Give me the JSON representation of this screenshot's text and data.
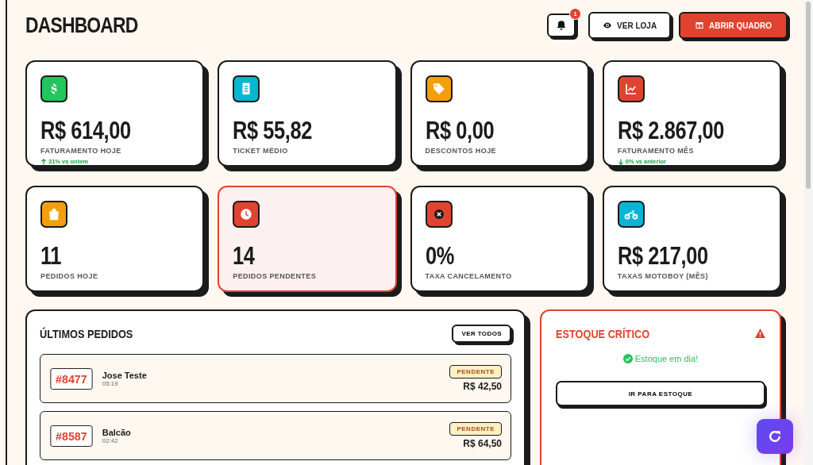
{
  "header": {
    "title": "DASHBOARD",
    "notifications": "1",
    "buttons": [
      {
        "label": "VER LOJA",
        "kind": "outline"
      },
      {
        "label": "ABRIR QUADRO",
        "kind": "primary"
      }
    ]
  },
  "stats": [
    {
      "kind": "dollar",
      "color": "#22c55e",
      "value": "R$ 614,00",
      "label": "FATURAMENTO HOJE",
      "trend": {
        "kind": "up",
        "text": "31% vs ontem"
      },
      "alert": false
    },
    {
      "kind": "receipt",
      "color": "#06b6d4",
      "value": "R$ 55,82",
      "label": "TICKET MÉDIO",
      "alert": false
    },
    {
      "kind": "tag",
      "color": "#f59e0b",
      "value": "R$ 0,00",
      "label": "DESCONTOS HOJE",
      "alert": false
    },
    {
      "kind": "chart",
      "color": "#e0432f",
      "value": "R$ 2.867,00",
      "label": "FATURAMENTO MÊS",
      "trend": {
        "kind": "down",
        "text": "0% vs anterior"
      },
      "alert": false
    },
    {
      "kind": "bag",
      "color": "#f59e0b",
      "value": "11",
      "label": "PEDIDOS HOJE",
      "alert": false
    },
    {
      "kind": "clock",
      "color": "#e0432f",
      "value": "14",
      "label": "PEDIDOS PENDENTES",
      "alert": true
    },
    {
      "kind": "cancel",
      "color": "#e0432f",
      "value": "0%",
      "label": "TAXA CANCELAMENTO",
      "alert": false
    },
    {
      "kind": "moto",
      "color": "#06b6d4",
      "value": "R$ 217,00",
      "label": "TAXAS MOTOBOY (MÊS)",
      "alert": false
    }
  ],
  "orders": {
    "title": "ÚLTIMOS PEDIDOS",
    "button": "VER TODOS",
    "items": [
      {
        "number": "#8477",
        "customer": "Jose Teste",
        "time": "05:19",
        "status": "PENDENTE",
        "total": "R$ 42,50"
      },
      {
        "number": "#8587",
        "customer": "Balcão",
        "time": "02:42",
        "status": "PENDENTE",
        "total": "R$ 64,50"
      }
    ]
  },
  "stock": {
    "title": "ESTOQUE CRÍTICO",
    "message": "Estoque em dia!",
    "button": "IR PARA ESTOQUE"
  }
}
